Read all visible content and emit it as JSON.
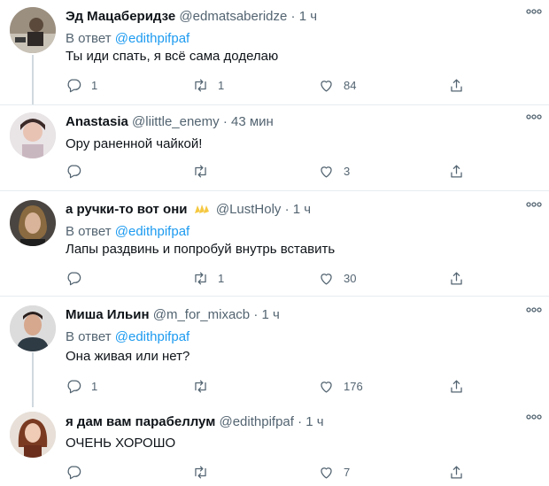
{
  "tweets": [
    {
      "name": "Эд Мацаберидзе",
      "handle": "@edmatsaberidze",
      "dot": "·",
      "time": "1 ч",
      "reply_prefix": "В ответ",
      "reply_mention": "@edithpifpaf",
      "text": "Ты иди спать, я всё сама доделаю",
      "replies": "1",
      "retweets": "1",
      "likes": "84"
    },
    {
      "name": "Anastasia",
      "handle": "@liittle_enemy",
      "dot": "·",
      "time": "43 мин",
      "text": "Ору раненной чайкой!",
      "replies": "",
      "retweets": "",
      "likes": "3"
    },
    {
      "name": "а ручки-то вот они",
      "handle": "@LustHoly",
      "dot": "·",
      "time": "1 ч",
      "reply_prefix": "В ответ",
      "reply_mention": "@edithpifpaf",
      "text": "Лапы раздвинь и попробуй внутрь вставить",
      "replies": "",
      "retweets": "1",
      "likes": "30"
    },
    {
      "name": "Миша Ильин",
      "handle": "@m_for_mixacb",
      "dot": "·",
      "time": "1 ч",
      "reply_prefix": "В ответ",
      "reply_mention": "@edithpifpaf",
      "text": "Она живая или нет?",
      "replies": "1",
      "retweets": "",
      "likes": "176"
    },
    {
      "name": "я дам вам парабеллум",
      "handle": "@edithpifpaf",
      "dot": "·",
      "time": "1 ч",
      "text": "ОЧЕНЬ ХОРОШО",
      "replies": "",
      "retweets": "",
      "likes": "7"
    }
  ],
  "icons": {
    "reply": "reply-icon",
    "retweet": "retweet-icon",
    "like": "heart-icon",
    "share": "share-icon",
    "more": "more-icon",
    "emoji": "raised-hands-emoji"
  },
  "colors": {
    "mention": "#1d9bf0",
    "secondary": "#536471",
    "divider": "#e6ecf0"
  }
}
